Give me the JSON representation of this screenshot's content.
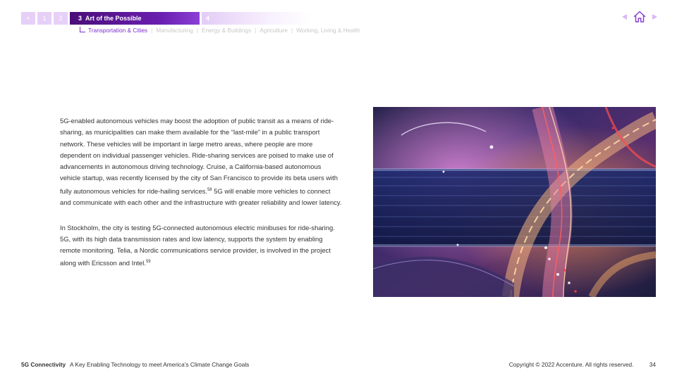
{
  "nav": {
    "items": [
      {
        "label": "+"
      },
      {
        "label": "1"
      },
      {
        "label": "2"
      }
    ],
    "active": {
      "number": "3",
      "label": "Art of the Possible"
    },
    "next": {
      "label": "4"
    }
  },
  "subnav": [
    {
      "label": "Transportation & Cities"
    },
    {
      "label": "Manufacturing"
    },
    {
      "label": "Energy & Buildings"
    },
    {
      "label": "Agriculture"
    },
    {
      "label": "Working, Living & Health"
    }
  ],
  "body": {
    "p1": "5G-enabled autonomous vehicles may boost the adoption of public transit as a means of ride-sharing, as municipalities can make them available for the “last-mile” in a public transport network. These vehicles will be important in large metro areas, where people are more dependent on individual passenger vehicles. Ride-sharing services are poised to make use of advancements in autonomous driving technology. Cruise, a California-based autonomous vehicle startup, was recently licensed by the city of San Francisco to provide its beta users with fully autonomous vehicles for ride-hailing services.",
    "p1_ref": "58",
    "p1_tail": " 5G will enable more vehicles to connect and communicate with each other and the infrastructure with greater reliability and lower latency.",
    "p2": "In Stockholm, the city is testing 5G-connected autonomous electric minibuses for ride-sharing. 5G, with its high data transmission rates and low latency, supports the system by enabling remote monitoring. Telia, a Nordic communications service provider, is involved in the project along with Ericsson and Intel.",
    "p2_ref": "59"
  },
  "footer": {
    "brand": "5G Connectivity",
    "subtitle": "A Key Enabling Technology to meet America’s Climate Change Goals",
    "copyright": "Copyright © 2022 Accenture. All rights reserved.",
    "page": "34"
  },
  "colors": {
    "accent": "#7b2fd0",
    "active_tab": "#4a0e78",
    "inactive_tab": "#e6d0f7"
  }
}
